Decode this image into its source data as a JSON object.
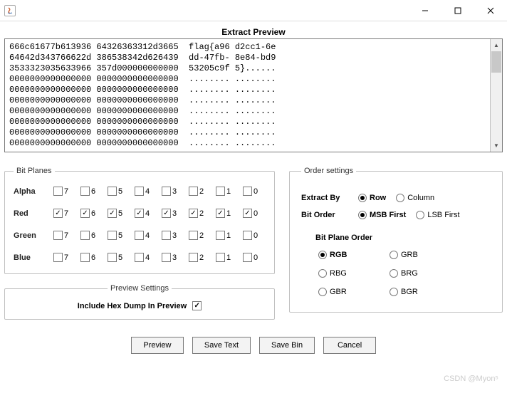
{
  "window": {
    "title": ""
  },
  "preview_title": "Extract Preview",
  "hex_dump": "666c61677b613936 64326363312d3665  flag{a96 d2cc1-6e\n64642d343766622d 386538342d626439  dd-47fb- 8e84-bd9\n3533323035633966 357d000000000000  53205c9f 5}......\n0000000000000000 0000000000000000  ........ ........\n0000000000000000 0000000000000000  ........ ........\n0000000000000000 0000000000000000  ........ ........\n0000000000000000 0000000000000000  ........ ........\n0000000000000000 0000000000000000  ........ ........\n0000000000000000 0000000000000000  ........ ........\n0000000000000000 0000000000000000  ........ ........",
  "bit_planes": {
    "legend": "Bit Planes",
    "rows": [
      {
        "name": "Alpha",
        "checks": [
          false,
          false,
          false,
          false,
          false,
          false,
          false,
          false
        ]
      },
      {
        "name": "Red",
        "checks": [
          true,
          true,
          true,
          true,
          true,
          true,
          true,
          true
        ]
      },
      {
        "name": "Green",
        "checks": [
          false,
          false,
          false,
          false,
          false,
          false,
          false,
          false
        ]
      },
      {
        "name": "Blue",
        "checks": [
          false,
          false,
          false,
          false,
          false,
          false,
          false,
          false
        ]
      }
    ],
    "cols": [
      "7",
      "6",
      "5",
      "4",
      "3",
      "2",
      "1",
      "0"
    ]
  },
  "preview_settings": {
    "legend": "Preview Settings",
    "label": "Include Hex Dump In Preview",
    "checked": true
  },
  "order_settings": {
    "legend": "Order settings",
    "extract_by": {
      "label": "Extract By",
      "options": [
        "Row",
        "Column"
      ],
      "selected": "Row"
    },
    "bit_order": {
      "label": "Bit Order",
      "options": [
        "MSB First",
        "LSB First"
      ],
      "selected": "MSB First"
    },
    "bit_plane_order": {
      "label": "Bit Plane Order",
      "options": [
        "RGB",
        "GRB",
        "RBG",
        "BRG",
        "GBR",
        "BGR"
      ],
      "selected": "RGB"
    }
  },
  "buttons": {
    "preview": "Preview",
    "save_text": "Save Text",
    "save_bin": "Save Bin",
    "cancel": "Cancel"
  },
  "watermark": "CSDN @Myon⁵"
}
